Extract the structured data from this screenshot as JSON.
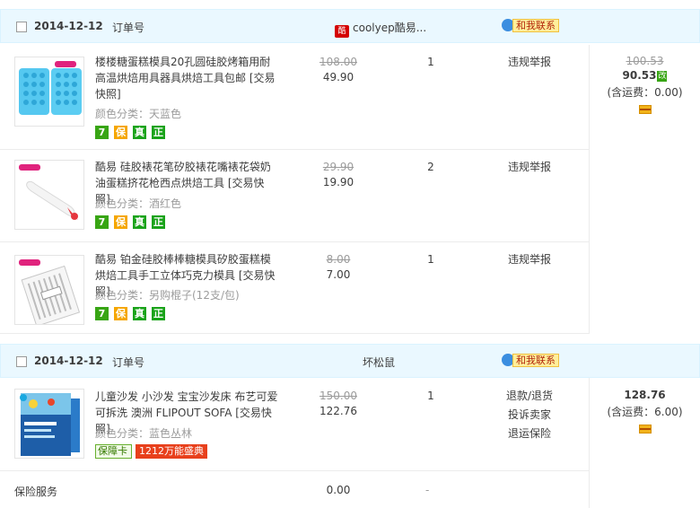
{
  "orders": [
    {
      "date": "2014-12-12",
      "order_no": "订单号",
      "shop": "coolyep酷易...",
      "contact": "和我联系",
      "total": {
        "original": "100.53",
        "value": "90.53",
        "changed_badge": "改",
        "shipping": "(含运费：0.00)"
      },
      "items": [
        {
          "title": "楼楼糖蛋糕模具20孔圆硅胶烤箱用耐高温烘焙用具器具烘焙工具包邮 [交易快照]",
          "sku": "颜色分类：天蓝色",
          "original_price": "108.00",
          "price": "49.90",
          "qty": "1",
          "ops": [
            "违规举报"
          ]
        },
        {
          "title": "酷易 硅胶裱花笔矽胶裱花嘴裱花袋奶油蛋糕挤花枪西点烘焙工具 [交易快照]",
          "sku": "颜色分类：酒红色",
          "original_price": "29.90",
          "price": "19.90",
          "qty": "2",
          "ops": [
            "违规举报"
          ]
        },
        {
          "title": "酷易 铂金硅胶棒棒糖模具矽胶蛋糕模烘焙工具手工立体巧克力模具 [交易快照]",
          "sku": "颜色分类：另购棍子(12支/包)",
          "original_price": "8.00",
          "price": "7.00",
          "qty": "1",
          "ops": [
            "违规举报"
          ]
        }
      ],
      "badges": [
        "7",
        "保",
        "真",
        "正"
      ]
    },
    {
      "date": "2014-12-12",
      "order_no": "订单号",
      "shop": "坏松鼠",
      "contact": "和我联系",
      "total": {
        "value": "128.76",
        "shipping": "(含运费：6.00)"
      },
      "items": [
        {
          "title": "儿童沙发 小沙发 宝宝沙发床 布艺可爱可拆洗 澳洲 FLIPOUT SOFA [交易快照]",
          "sku": "颜色分类：蓝色丛林",
          "original_price": "150.00",
          "price": "122.76",
          "qty": "1",
          "ops": [
            "退款/退货",
            "投诉卖家",
            "退运保险"
          ],
          "promo": {
            "card": "保障卡",
            "festival": "1212万能盛典"
          }
        }
      ]
    }
  ],
  "insurance": {
    "label": "保险服务",
    "amount": "0.00",
    "qty": "-"
  },
  "colors": {
    "header_bg": "#eaf8ff",
    "badge_green": "#38a514",
    "promo_red": "#e8401c"
  }
}
